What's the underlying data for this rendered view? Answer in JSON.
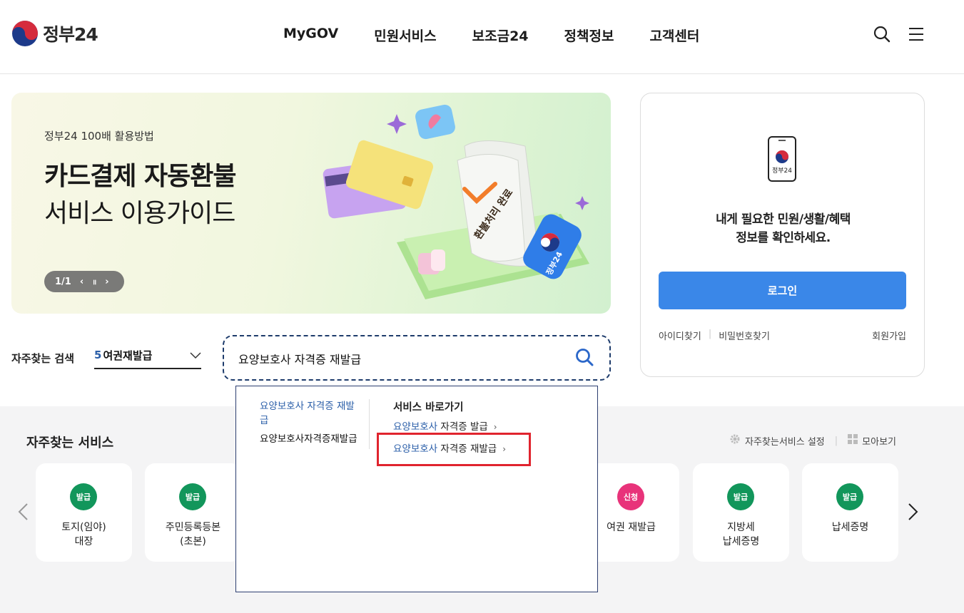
{
  "header": {
    "logo_text": "정부24",
    "nav": [
      "MyGOV",
      "민원서비스",
      "보조금24",
      "정책정보",
      "고객센터"
    ]
  },
  "banner": {
    "subtitle": "정부24 100배 활용방법",
    "title_bold": "카드결제 자동환불",
    "title_light": "서비스 이용가이드",
    "pager_text": "1/1",
    "prev": "‹",
    "pause": "॥",
    "next": "›",
    "receipt_text": "환불처리 완료",
    "badge_text": "정부24"
  },
  "login": {
    "phone_label": "정부24",
    "message_line1": "내게 필요한 민원/생활/혜택",
    "message_line2": "정보를 확인하세요.",
    "button": "로그인",
    "find_id": "아이디찾기",
    "find_pw": "비밀번호찾기",
    "signup": "회원가입"
  },
  "search": {
    "freq_label": "자주찾는 검색",
    "freq_rank": "5",
    "freq_value": "여권재발급",
    "query": "요양보호사 자격증 재발급"
  },
  "autocomplete": {
    "suggestions": [
      "요양보호사 자격증 재발급",
      "요양보호사자격증재발급"
    ],
    "shortcut_heading": "서비스 바로가기",
    "shortcuts": [
      {
        "highlight": "요양보호사",
        "rest": " 자격증 발급"
      },
      {
        "highlight": "요양보호사",
        "rest": " 자격증 재발급"
      }
    ]
  },
  "services": {
    "title": "자주찾는 서비스",
    "settings": "자주찾는서비스 설정",
    "view_all": "모아보기",
    "cards": [
      {
        "badge": "발급",
        "label": "토지(임야)\n대장",
        "color": "#12965b"
      },
      {
        "badge": "발급",
        "label": "주민등록등본\n(초본)",
        "color": "#12965b"
      },
      {
        "badge": "신청",
        "label": "여권 재발급",
        "color": "#e8337a"
      },
      {
        "badge": "발급",
        "label": "지방세\n납세증명",
        "color": "#12965b"
      },
      {
        "badge": "발급",
        "label": "납세증명",
        "color": "#12965b"
      }
    ]
  }
}
